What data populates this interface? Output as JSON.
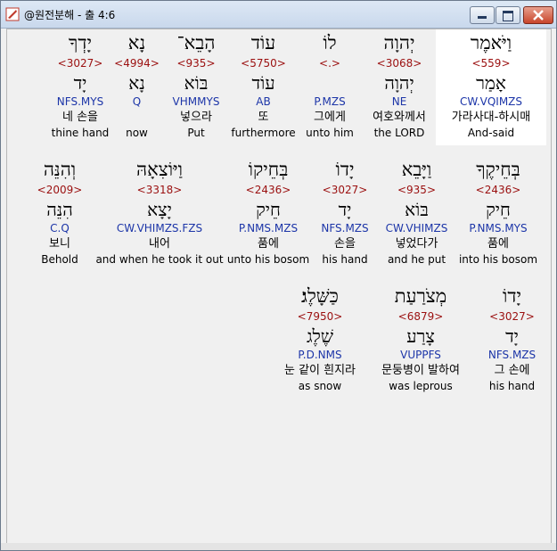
{
  "window": {
    "title": "@원전분해 - 출 4:6"
  },
  "words": [
    {
      "heb": "וַיֹּאמֶר",
      "num": "<559>",
      "lemma": "אָמַר",
      "parse": "CW.VQIMZS",
      "kor": "가라사대-하시매",
      "eng": "And-said",
      "selected": true
    },
    {
      "heb": "יְהוָה",
      "num": "<3068>",
      "lemma": "יְהוָה",
      "parse": "NE",
      "kor": "여호와께서",
      "eng": "the LORD"
    },
    {
      "heb": "לוֹ",
      "num": "<.>",
      "lemma": "",
      "parse": "P.MZS",
      "kor": "그에게",
      "eng": "unto him"
    },
    {
      "heb": "עוֹד",
      "num": "<5750>",
      "lemma": "עוֹד",
      "parse": "AB",
      "kor": "또",
      "eng": "furthermore"
    },
    {
      "heb": "הָבֵא־",
      "num": "<935>",
      "lemma": "בּוֹא",
      "parse": "VHMMYS",
      "kor": "넣으라",
      "eng": "Put"
    },
    {
      "heb": "נָא",
      "num": "<4994>",
      "lemma": "נָא",
      "parse": "Q",
      "kor": "",
      "eng": "now"
    },
    {
      "heb": "יָדְךָ",
      "num": "<3027>",
      "lemma": "יָד",
      "parse": "NFS.MYS",
      "kor": "네 손을",
      "eng": "thine hand"
    },
    {
      "heb": "בְּחֵיקֶךָ",
      "num": "<2436>",
      "lemma": "חֵיק",
      "parse": "P.NMS.MYS",
      "kor": "품에",
      "eng": "into his bosom"
    },
    {
      "heb": "וַיָּבֵא",
      "num": "<935>",
      "lemma": "בּוֹא",
      "parse": "CW.VHIMZS",
      "kor": "넣었다가",
      "eng": "and he put"
    },
    {
      "heb": "יָדוֹ",
      "num": "<3027>",
      "lemma": "יָד",
      "parse": "NFS.MZS",
      "kor": "손을",
      "eng": "his hand"
    },
    {
      "heb": "בְּחֵיקוֹ",
      "num": "<2436>",
      "lemma": "חֵיק",
      "parse": "P.NMS.MZS",
      "kor": "품에",
      "eng": "unto his bosom"
    },
    {
      "heb": "וַיּוֹצִאָהּ",
      "num": "<3318>",
      "lemma": "יָצָא",
      "parse": "CW.VHIMZS.FZS",
      "kor": "내어",
      "eng": "and when he took it out"
    },
    {
      "heb": "וְהִנֵּה",
      "num": "<2009>",
      "lemma": "הִנֵּה",
      "parse": "C.Q",
      "kor": "보니",
      "eng": "Behold"
    },
    {
      "heb": "יָדוֹ",
      "num": "<3027>",
      "lemma": "יָד",
      "parse": "NFS.MZS",
      "kor": "그 손에",
      "eng": "his hand"
    },
    {
      "heb": "מְצֹרַעַת",
      "num": "<6879>",
      "lemma": "צָרַע",
      "parse": "VUPPFS",
      "kor": "문둥병이 발하여",
      "eng": "was leprous"
    },
    {
      "heb": "כַּשָּׁלֶג׃",
      "num": "<7950>",
      "lemma": "שֶׁלֶג",
      "parse": "P.D.NMS",
      "kor": "눈 같이 흰지라",
      "eng": "as snow"
    }
  ]
}
